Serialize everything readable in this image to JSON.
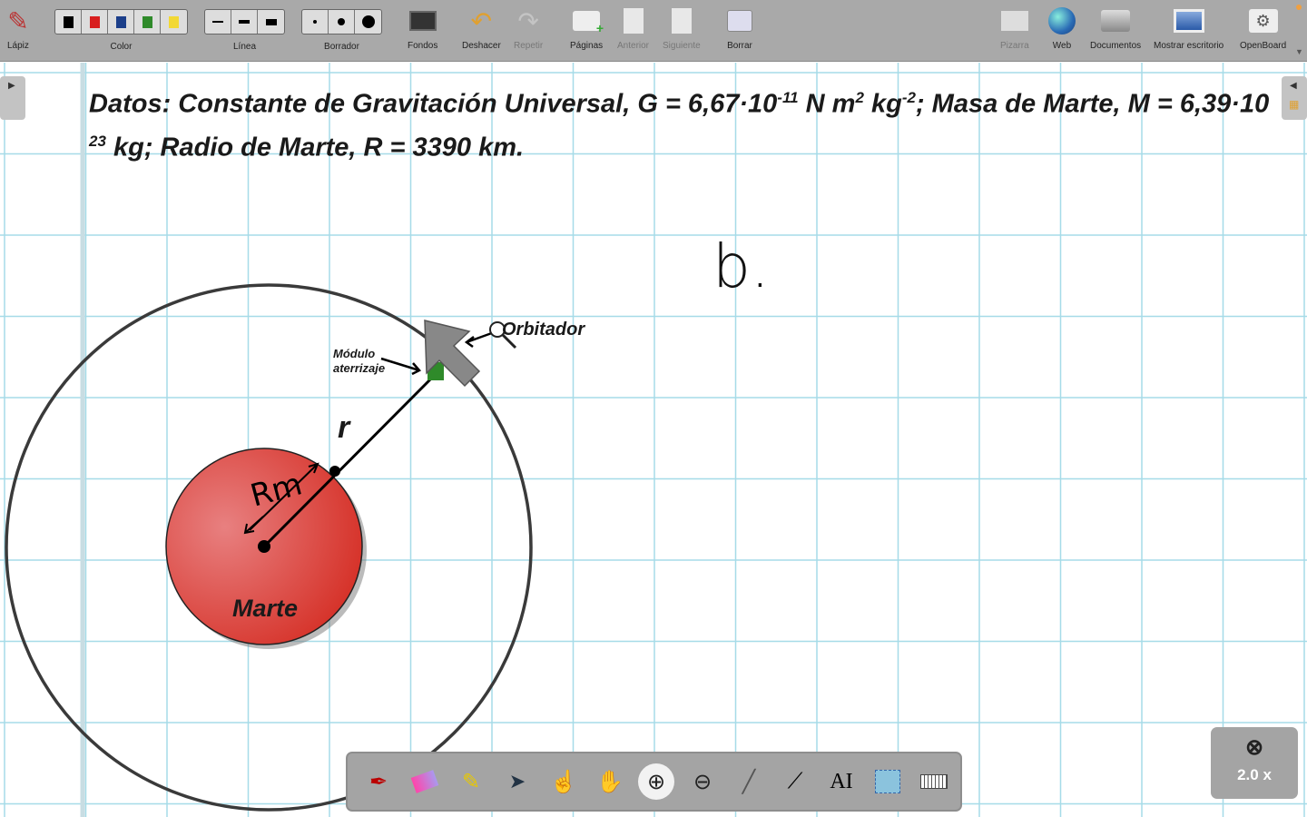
{
  "toolbar": {
    "pencil": "Lápiz",
    "color": "Color",
    "line": "Línea",
    "eraser": "Borrador",
    "backgrounds": "Fondos",
    "undo": "Deshacer",
    "redo": "Repetir",
    "pages": "Páginas",
    "previous": "Anterior",
    "next": "Siguiente",
    "clear": "Borrar",
    "board": "Pizarra",
    "web": "Web",
    "documents": "Documentos",
    "show_desktop": "Mostrar escritorio",
    "openboard": "OpenBoard",
    "colors": [
      "#000000",
      "#d81e1e",
      "#1c3f8a",
      "#2f8a2a",
      "#f2d835"
    ]
  },
  "content": {
    "data_line1_a": "Datos: Constante de Gravitación Universal, G = 6,67·10",
    "exp1": "-11",
    "data_line1_b": " N m",
    "exp2": "2",
    "data_line1_c": " kg",
    "exp3": "-2",
    "data_line1_d": "; Masa de Marte, M = 6,39·10",
    "exp4": "23",
    "data_line2": " kg; Radio de Marte, R = 3390 km.",
    "label_b": "b.",
    "label_r": "r",
    "label_rm": "Rm",
    "label_marte": "Marte",
    "label_module_1": "Módulo",
    "label_module_2": "aterrizaje",
    "label_orbiter": "Orbitador"
  },
  "zoom": {
    "level": "2.0 x"
  }
}
